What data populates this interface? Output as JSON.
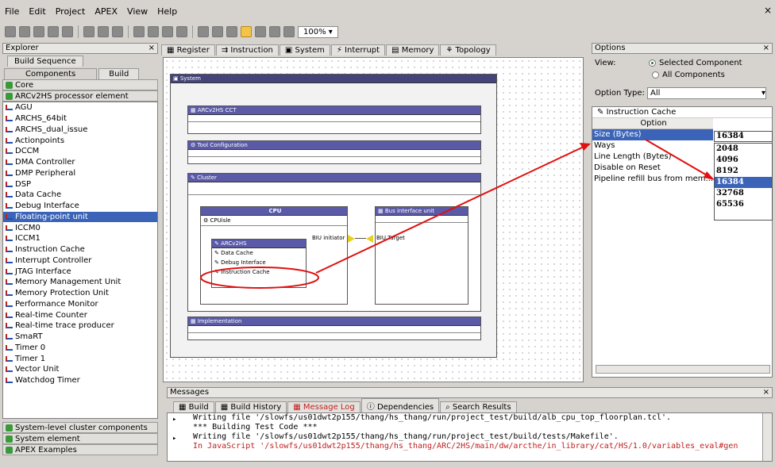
{
  "menu": [
    "File",
    "Edit",
    "Project",
    "APEX",
    "View",
    "Help"
  ],
  "toolbar": {
    "zoom": "100%"
  },
  "explorer": {
    "title": "Explorer",
    "close": "×",
    "tab_top": "Build Sequence",
    "tabs": [
      "Components",
      "Build"
    ],
    "categories_top": [
      "Core",
      "ARCv2HS processor element"
    ],
    "items": [
      "AGU",
      "ARCHS_64bit",
      "ARCHS_dual_issue",
      "Actionpoints",
      "DCCM",
      "DMA Controller",
      "DMP Peripheral",
      "DSP",
      "Data Cache",
      "Debug Interface",
      "Floating-point unit",
      "ICCM0",
      "ICCM1",
      "Instruction Cache",
      "Interrupt Controller",
      "JTAG Interface",
      "Memory Management Unit",
      "Memory Protection Unit",
      "Performance Monitor",
      "Real-time Counter",
      "Real-time trace producer",
      "SmaRT",
      "Timer 0",
      "Timer 1",
      "Vector Unit",
      "Watchdog Timer"
    ],
    "selected": "Floating-point unit",
    "categories_bottom": [
      "System-level cluster components",
      "System element",
      "APEX Examples"
    ]
  },
  "editor": {
    "tabs": [
      "Register",
      "Instruction",
      "System",
      "Interrupt",
      "Memory",
      "Topology"
    ],
    "diagram": {
      "system": "System",
      "cct": "ARCv2HS CCT",
      "toolcfg": "Tool Configuration",
      "cluster": "Cluster",
      "cpu": "CPU",
      "cpuisle": "CPUisle",
      "arcv2hs": "ARCv2HS",
      "dcache": "Data Cache",
      "dbg": "Debug Interface",
      "icache": "Instruction Cache",
      "biu_unit": "Bus interface unit",
      "biu_init": "BIU initiator",
      "biu_target": "BIU Target",
      "impl": "Implementation"
    }
  },
  "options": {
    "title": "Options",
    "view_label": "View:",
    "radio_selected": "Selected Component",
    "radio_all": "All Components",
    "type_label": "Option Type:",
    "type_value": "All",
    "component": "Instruction Cache",
    "col_header": "Option",
    "rows": [
      "Size (Bytes)",
      "Ways",
      "Line Length (Bytes)",
      "Disable on Reset",
      "Pipeline refill bus from mem..."
    ],
    "value": "16384",
    "dropdown": [
      "2048",
      "4096",
      "8192",
      "16384",
      "32768",
      "65536"
    ],
    "dropdown_selected": "16384"
  },
  "messages": {
    "title": "Messages",
    "tabs": [
      "Build",
      "Build History",
      "Message Log",
      "Dependencies",
      "Search Results"
    ],
    "lines": [
      "Writing file '/slowfs/us01dwt2p155/thang/hs_thang/run/project_test/build/alb_cpu_top_floorplan.tcl'.",
      "*** Building Test Code ***",
      "Writing file '/slowfs/us01dwt2p155/thang/hs_thang/run/project_test/build/tests/Makefile'.",
      "In JavaScript '/slowfs/us01dwt2p155/thang/hs_thang/ARC/2HS/main/dw/arcthe/in_library/cat/HS/1.0/variables_eval#gen"
    ]
  },
  "colors": {
    "selection": "#3b64b8",
    "header": "#5a5aa8",
    "arrow": "#e01010"
  }
}
